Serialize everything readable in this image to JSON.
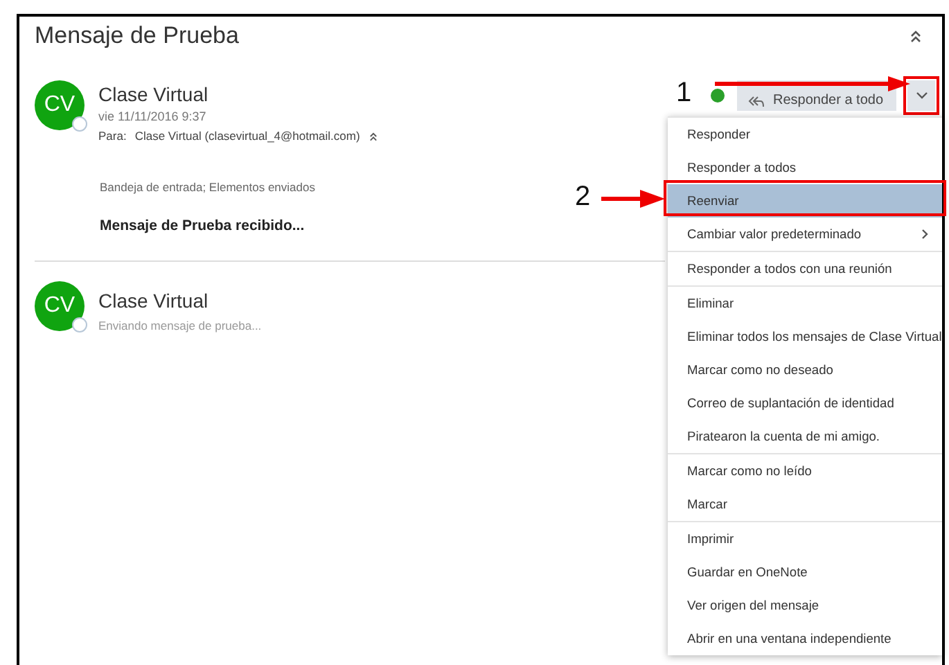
{
  "header": {
    "title": "Mensaje de Prueba"
  },
  "messages": [
    {
      "kind": "expanded",
      "initials": "CV",
      "sender": "Clase Virtual",
      "date": "vie 11/11/2016 9:37",
      "to_label": "Para:",
      "to": "Clase Virtual (clasevirtual_4@hotmail.com)",
      "folders": "Bandeja de entrada; Elementos enviados",
      "body": "Mensaje de Prueba recibido..."
    },
    {
      "kind": "collapsed",
      "initials": "CV",
      "sender": "Clase Virtual",
      "preview": "Enviando mensaje de prueba..."
    }
  ],
  "reply_button": {
    "label": "Responder a todo"
  },
  "menu": {
    "groups": [
      [
        {
          "label": "Responder",
          "selected": false,
          "submenu": false
        },
        {
          "label": "Responder a todos",
          "selected": false,
          "submenu": false
        },
        {
          "label": "Reenviar",
          "selected": true,
          "submenu": false
        },
        {
          "label": "Cambiar valor predeterminado",
          "selected": false,
          "submenu": true
        }
      ],
      [
        {
          "label": "Responder a todos con una reunión",
          "selected": false,
          "submenu": false
        }
      ],
      [
        {
          "label": "Eliminar",
          "selected": false,
          "submenu": false
        },
        {
          "label": "Eliminar todos los mensajes de Clase Virtual",
          "selected": false,
          "submenu": false
        },
        {
          "label": "Marcar como no deseado",
          "selected": false,
          "submenu": false
        },
        {
          "label": "Correo de suplantación de identidad",
          "selected": false,
          "submenu": false
        },
        {
          "label": "Piratearon la cuenta de mi amigo.",
          "selected": false,
          "submenu": false
        }
      ],
      [
        {
          "label": "Marcar como no leído",
          "selected": false,
          "submenu": false
        },
        {
          "label": "Marcar",
          "selected": false,
          "submenu": false
        }
      ],
      [
        {
          "label": "Imprimir",
          "selected": false,
          "submenu": false
        },
        {
          "label": "Guardar en OneNote",
          "selected": false,
          "submenu": false
        },
        {
          "label": "Ver origen del mensaje",
          "selected": false,
          "submenu": false
        },
        {
          "label": "Abrir en una ventana independiente",
          "selected": false,
          "submenu": false
        }
      ]
    ]
  },
  "annotations": [
    {
      "label": "1"
    },
    {
      "label": "2"
    }
  ]
}
